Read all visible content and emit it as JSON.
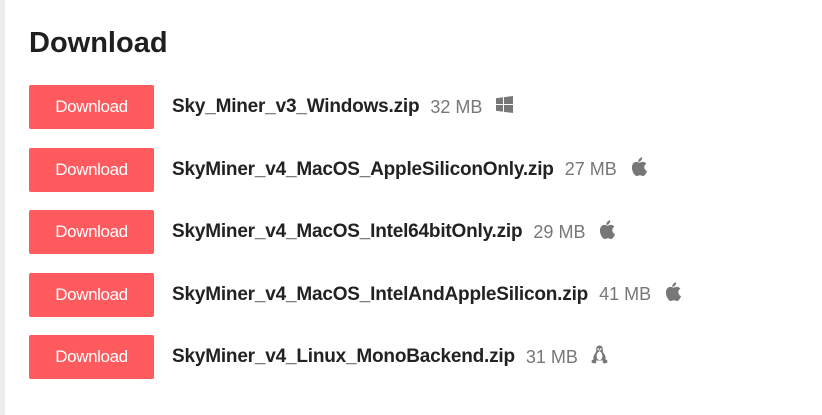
{
  "section": {
    "title": "Download"
  },
  "downloads": [
    {
      "button_label": "Download",
      "filename": "Sky_Miner_v3_Windows.zip",
      "size": "32 MB",
      "os_icon": "windows-icon"
    },
    {
      "button_label": "Download",
      "filename": "SkyMiner_v4_MacOS_AppleSiliconOnly.zip",
      "size": "27 MB",
      "os_icon": "apple-icon"
    },
    {
      "button_label": "Download",
      "filename": "SkyMiner_v4_MacOS_Intel64bitOnly.zip",
      "size": "29 MB",
      "os_icon": "apple-icon"
    },
    {
      "button_label": "Download",
      "filename": "SkyMiner_v4_MacOS_IntelAndAppleSilicon.zip",
      "size": "41 MB",
      "os_icon": "apple-icon"
    },
    {
      "button_label": "Download",
      "filename": "SkyMiner_v4_Linux_MonoBackend.zip",
      "size": "31 MB",
      "os_icon": "linux-icon"
    }
  ],
  "colors": {
    "button_background": "#ff5b5f",
    "button_text": "#ffffff",
    "filename_text": "#222222",
    "size_text": "#777777",
    "icon": "#777777"
  }
}
